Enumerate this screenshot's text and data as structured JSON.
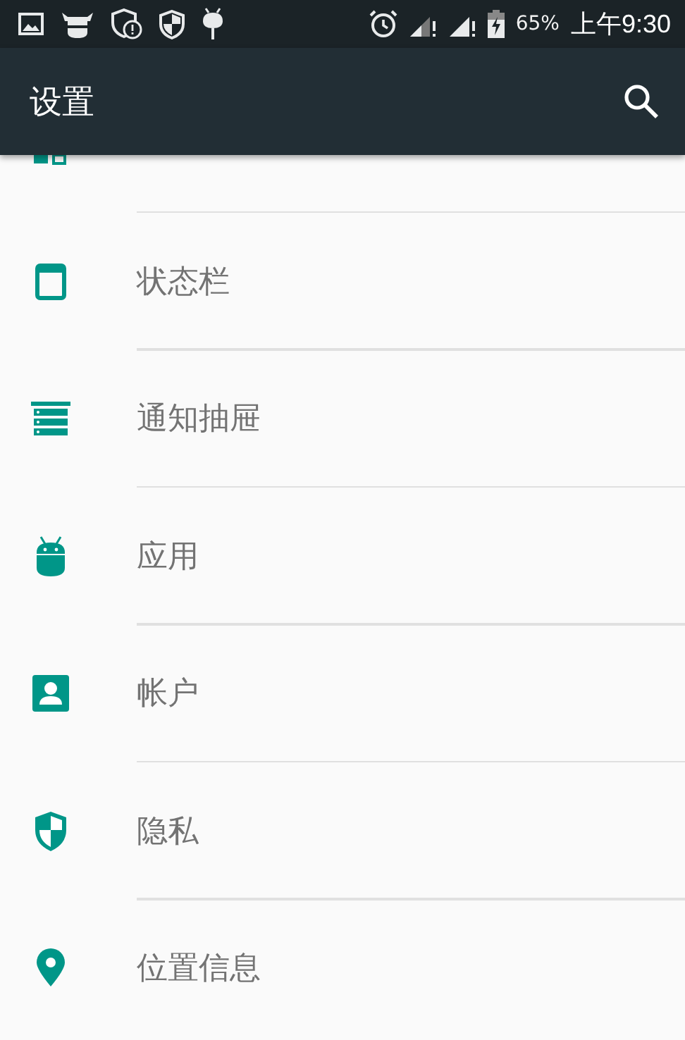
{
  "status_bar": {
    "battery": "65%",
    "time": "上午9:30"
  },
  "app_bar": {
    "title": "设置"
  },
  "items": [
    {
      "label": "状态栏"
    },
    {
      "label": "通知抽屉"
    },
    {
      "label": "应用"
    },
    {
      "label": "帐户"
    },
    {
      "label": "隐私"
    },
    {
      "label": "位置信息"
    }
  ]
}
